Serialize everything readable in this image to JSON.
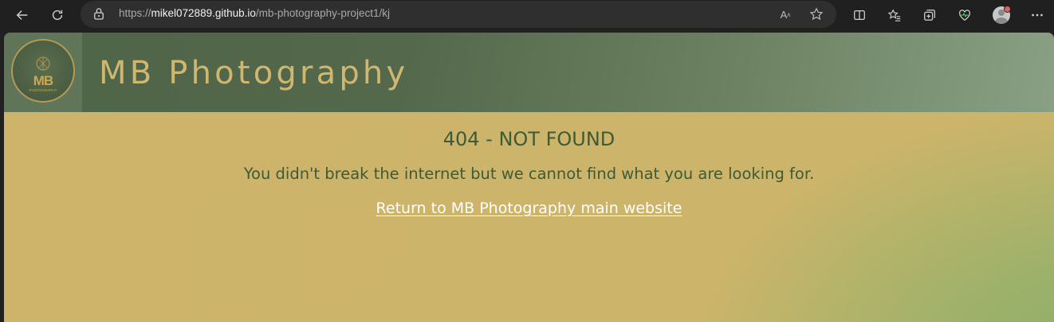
{
  "browser": {
    "url_scheme": "https://",
    "url_host": "mikel072889.github.io",
    "url_path": "/mb-photography-project1/kj",
    "read_aloud_icon_text": "A"
  },
  "site": {
    "title": "MB Photography",
    "logo_text": "MB",
    "logo_subtext": "PHOTOGRAPHY"
  },
  "error": {
    "heading": "404 - NOT FOUND",
    "message": "You didn't break the internet but we cannot find what you are looking for.",
    "link_label": "Return to MB Photography main website"
  },
  "colors": {
    "header_dark": "#4f6548",
    "gold": "#cfb76f",
    "page_bg": "#cdb46a",
    "text_green": "#3e5a37"
  }
}
